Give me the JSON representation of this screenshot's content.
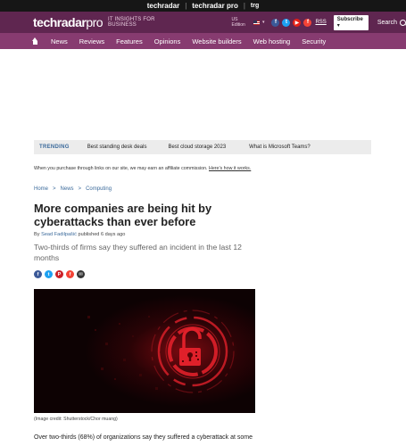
{
  "brandbar": {
    "items": [
      "techradar",
      "techradar pro",
      "trg"
    ],
    "separator": "|"
  },
  "header": {
    "logo_main": "techradar",
    "logo_suffix": "pro",
    "tagline": "IT INSIGHTS FOR BUSINESS",
    "edition": "US Edition",
    "socials": [
      "f",
      "t",
      "▶",
      "f"
    ],
    "rss": "RSS",
    "subscribe": "Subscribe",
    "subscribe_caret": "▾",
    "search": "Search"
  },
  "nav": {
    "items": [
      "News",
      "Reviews",
      "Features",
      "Opinions",
      "Website builders",
      "Web hosting",
      "Security"
    ]
  },
  "trending": {
    "label": "TRENDING",
    "items": [
      "Best standing desk deals",
      "Best cloud storage 2023",
      "What is Microsoft Teams?"
    ]
  },
  "affiliate": {
    "text": "When you purchase through links on our site, we may earn an affiliate commission.",
    "link": "Here’s how it works."
  },
  "breadcrumb": {
    "items": [
      "Home",
      "News",
      "Computing"
    ],
    "separator": ">"
  },
  "article": {
    "title": "More companies are being hit by cyberattacks than ever before",
    "by": "By",
    "author": "Sead Fadilpašić",
    "published": "published 6 days ago",
    "subtitle": "Two-thirds of firms say they suffered an incident in the last 12 months",
    "share": [
      "f",
      "t",
      "P",
      "f",
      "✉"
    ],
    "image_credit": "(Image credit: Shutterstock/Chor muang)",
    "body_start": "Over two-thirds (68%) of organizations say they suffered a cyberattack at some"
  },
  "colors": {
    "header_bg": "#5f2650",
    "nav_bg": "#873b70",
    "link": "#3b6a9b",
    "lock_red": "#e0202a"
  }
}
